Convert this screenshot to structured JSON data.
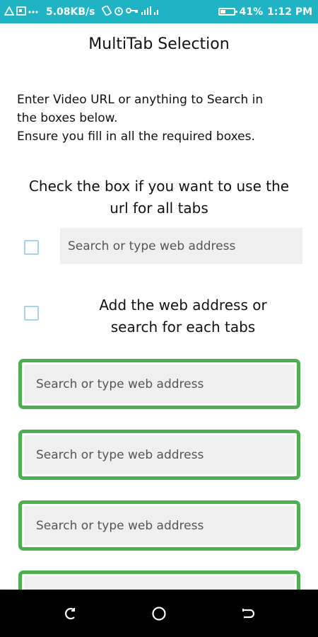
{
  "status_bar": {
    "left_icons": [
      "warning-icon",
      "screenshot-icon",
      "more-icon"
    ],
    "speed": "5.08KB/s",
    "mid_icons": [
      "rotate-icon",
      "alarm-icon",
      "key-icon",
      "signal-icon"
    ],
    "battery_text": "41%",
    "battery_level": 0.41,
    "time": "1:12 PM",
    "color": "#1fb3c4"
  },
  "page": {
    "title": "MultiTab Selection",
    "instructions": [
      "Enter Video URL or anything to Search in",
      "the boxes below.",
      "Ensure you fill in all the required boxes."
    ],
    "use_for_all_label_line1": "Check the box if you want to use the",
    "use_for_all_label_line2": "url for all tabs",
    "all_url_placeholder": "Search or type web address",
    "each_label_line1": "Add the web address or",
    "each_label_line2": "search for each tabs",
    "tab_placeholders": [
      "Search or type web address",
      "Search or type web address",
      "Search or type web address",
      ""
    ],
    "accent_color": "#4caf50"
  },
  "nav_bar": {
    "buttons": [
      "back-icon",
      "home-icon",
      "recent-apps-icon"
    ]
  }
}
